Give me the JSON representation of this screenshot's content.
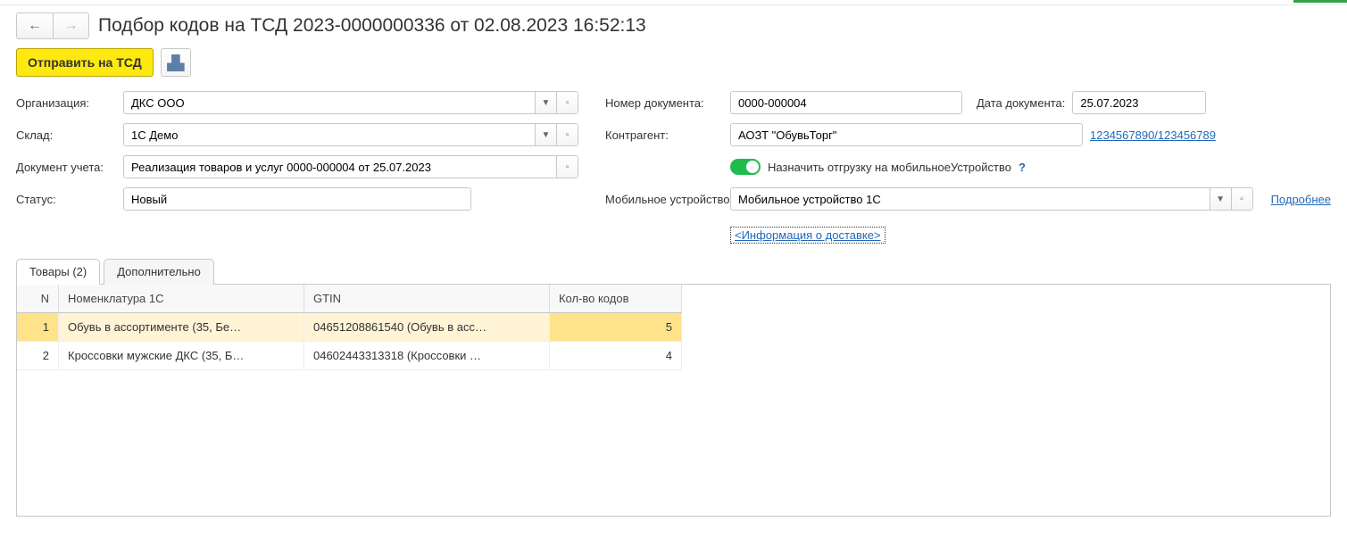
{
  "title": "Подбор кодов на ТСД 2023-0000000336 от 02.08.2023 16:52:13",
  "toolbar": {
    "send_label": "Отправить на ТСД"
  },
  "form": {
    "org_label": "Организация:",
    "org_value": "ДКС ООО",
    "warehouse_label": "Склад:",
    "warehouse_value": "1С Демо",
    "docref_label": "Документ учета:",
    "docref_value": "Реализация товаров и услуг 0000-000004 от 25.07.2023",
    "status_label": "Статус:",
    "status_value": "Новый",
    "docnum_label": "Номер документа:",
    "docnum_value": "0000-000004",
    "docdate_label": "Дата документа:",
    "docdate_value": "25.07.2023",
    "partner_label": "Контрагент:",
    "partner_value": "АОЗТ \"ОбувьТорг\"",
    "partner_link": "1234567890/123456789",
    "assign_label": "Назначить отгрузку на мобильноеУстройство",
    "mobile_label": "Мобильное устройство:",
    "mobile_value": "Мобильное устройство 1С",
    "more_link": "Подробнее",
    "delivery_info": "<Информация о доставке>"
  },
  "tabs": {
    "goods": "Товары (2)",
    "additional": "Дополнительно"
  },
  "table": {
    "headers": {
      "n": "N",
      "nom": "Номенклатура 1С",
      "gtin": "GTIN",
      "qty": "Кол-во кодов"
    },
    "rows": [
      {
        "n": "1",
        "nom": "Обувь в ассортименте (35, Бе…",
        "gtin": "04651208861540 (Обувь в асс…",
        "qty": "5"
      },
      {
        "n": "2",
        "nom": "Кроссовки мужские ДКС (35, Б…",
        "gtin": "04602443313318 (Кроссовки …",
        "qty": "4"
      }
    ]
  }
}
